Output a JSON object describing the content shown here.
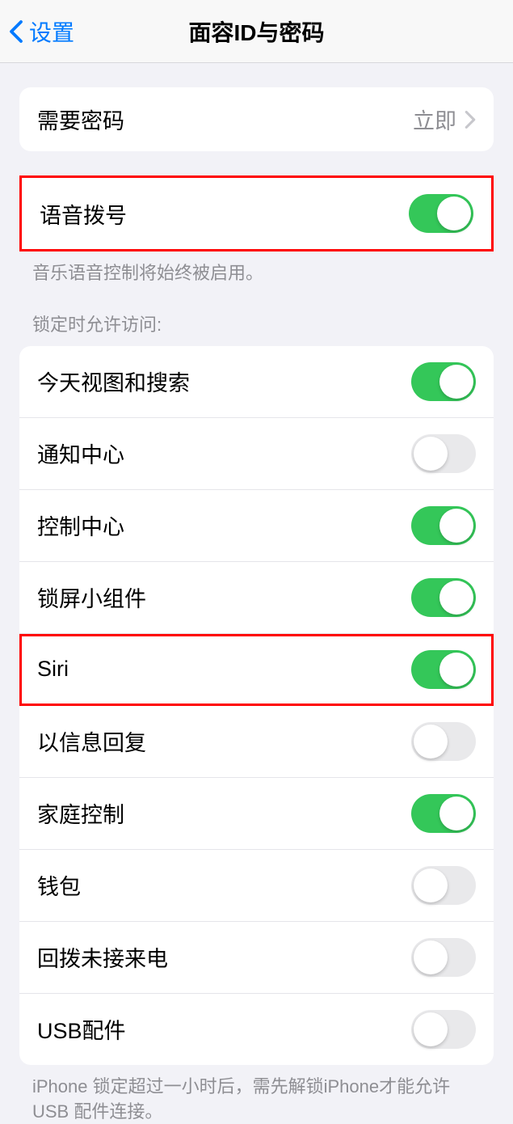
{
  "nav": {
    "back_label": "设置",
    "title": "面容ID与密码"
  },
  "require_passcode": {
    "label": "需要密码",
    "value": "立即"
  },
  "voice_dial": {
    "label": "语音拨号",
    "on": true,
    "footer": "音乐语音控制将始终被启用。"
  },
  "lock_access": {
    "header": "锁定时允许访问:",
    "items": [
      {
        "label": "今天视图和搜索",
        "on": true
      },
      {
        "label": "通知中心",
        "on": false
      },
      {
        "label": "控制中心",
        "on": true
      },
      {
        "label": "锁屏小组件",
        "on": true
      },
      {
        "label": "Siri",
        "on": true
      },
      {
        "label": "以信息回复",
        "on": false
      },
      {
        "label": "家庭控制",
        "on": true
      },
      {
        "label": "钱包",
        "on": false
      },
      {
        "label": "回拨未接来电",
        "on": false
      },
      {
        "label": "USB配件",
        "on": false
      }
    ],
    "footer": "iPhone 锁定超过一小时后，需先解锁iPhone才能允许USB 配件连接。"
  }
}
